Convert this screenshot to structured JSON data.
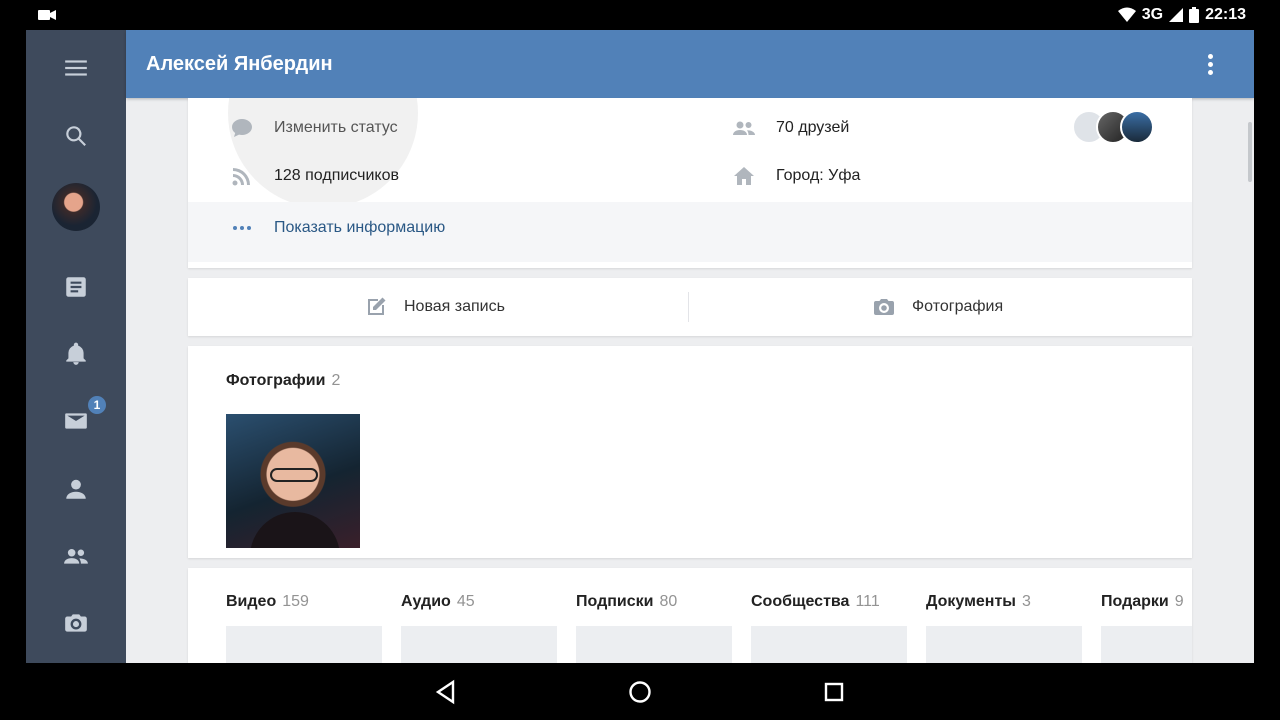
{
  "status_bar": {
    "network": "3G",
    "time": "22:13"
  },
  "header": {
    "title": "Алексей Янбердин"
  },
  "sidebar": {
    "items": [
      {
        "icon": "menu-icon"
      },
      {
        "icon": "search-icon"
      },
      {
        "icon": "avatar"
      },
      {
        "icon": "news-icon"
      },
      {
        "icon": "bell-icon"
      },
      {
        "icon": "mail-icon",
        "badge": "1"
      },
      {
        "icon": "person-icon"
      },
      {
        "icon": "friends-icon"
      },
      {
        "icon": "camera-icon"
      }
    ]
  },
  "profile": {
    "status_action": "Изменить статус",
    "friends": "70 друзей",
    "followers": "128 подписчиков",
    "city": "Город: Уфа",
    "show_info": "Показать информацию"
  },
  "actions": {
    "new_post": "Новая запись",
    "photo": "Фотография"
  },
  "photos": {
    "title": "Фотографии",
    "count": "2"
  },
  "counters": [
    {
      "label": "Видео",
      "count": "159"
    },
    {
      "label": "Аудио",
      "count": "45"
    },
    {
      "label": "Подписки",
      "count": "80"
    },
    {
      "label": "Сообщества",
      "count": "111"
    },
    {
      "label": "Документы",
      "count": "3"
    },
    {
      "label": "Подарки",
      "count": "9"
    }
  ],
  "colors": {
    "accent": "#5181b8",
    "sidebar": "#3e4a5c",
    "link": "#2a5885"
  }
}
